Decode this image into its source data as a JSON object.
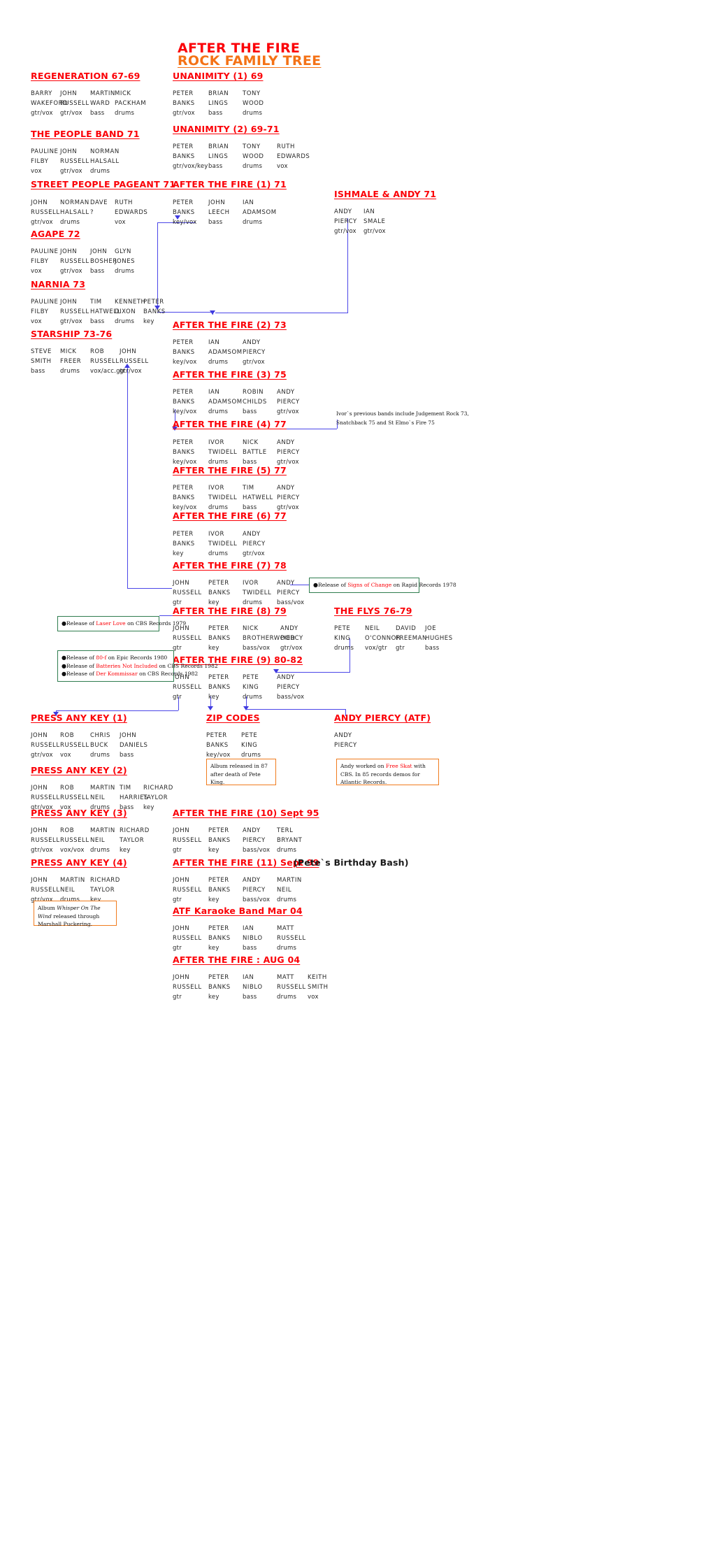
{
  "title": {
    "line1": "AFTER THE FIRE",
    "line2": "ROCK FAMILY TREE",
    "color_line1": "#fb0007",
    "color_line2": "#f47216"
  },
  "colors": {
    "heading": "#fb0007",
    "connector": "#4b46e8",
    "note_green_border": "#2f7d4f",
    "note_orange_border": "#f07c1e",
    "text": "#262626"
  },
  "bands": [
    {
      "id": "regeneration",
      "heading": "REGENERATION 67-69",
      "members": [
        {
          "first": "BARRY",
          "last": "WAKEFORD",
          "role": "gtr/vox"
        },
        {
          "first": "JOHN",
          "last": "RUSSELL",
          "role": "gtr/vox"
        },
        {
          "first": "MARTIN",
          "last": "WARD",
          "role": "bass"
        },
        {
          "first": "MICK",
          "last": "PACKHAM",
          "role": "drums"
        }
      ]
    },
    {
      "id": "people-band",
      "heading": "THE PEOPLE BAND 71",
      "members": [
        {
          "first": "PAULINE",
          "last": "FILBY",
          "role": "vox"
        },
        {
          "first": "JOHN",
          "last": "RUSSELL",
          "role": "gtr/vox"
        },
        {
          "first": "NORMAN",
          "last": "HALSALL",
          "role": "drums"
        }
      ]
    },
    {
      "id": "street-people-pageant",
      "heading": "STREET PEOPLE PAGEANT 71",
      "members": [
        {
          "first": "JOHN",
          "last": "RUSSELL",
          "role": "gtr/vox"
        },
        {
          "first": "NORMAN",
          "last": "HALSALL",
          "role": "drums"
        },
        {
          "first": "DAVE",
          "last": "?",
          "role": ""
        },
        {
          "first": "RUTH",
          "last": "EDWARDS",
          "role": "vox"
        }
      ]
    },
    {
      "id": "agape",
      "heading": "AGAPE 72",
      "members": [
        {
          "first": "PAULINE",
          "last": "FILBY",
          "role": "vox"
        },
        {
          "first": "JOHN",
          "last": "RUSSELL",
          "role": "gtr/vox"
        },
        {
          "first": "JOHN",
          "last": "BOSHER",
          "role": "bass"
        },
        {
          "first": "GLYN",
          "last": "JONES",
          "role": "drums"
        }
      ]
    },
    {
      "id": "narnia",
      "heading": "NARNIA 73",
      "members": [
        {
          "first": "PAULINE",
          "last": "FILBY",
          "role": "vox"
        },
        {
          "first": "JOHN",
          "last": "RUSSELL",
          "role": "gtr/vox"
        },
        {
          "first": "TIM",
          "last": "HATWELL",
          "role": "bass"
        },
        {
          "first": "KENNETH",
          "last": "DIXON",
          "role": "drums"
        },
        {
          "first": "PETER",
          "last": "BANKS",
          "role": "key"
        }
      ]
    },
    {
      "id": "starship",
      "heading": "STARSHIP 73-76",
      "members": [
        {
          "first": "STEVE",
          "last": "SMITH",
          "role": "bass"
        },
        {
          "first": "MICK",
          "last": "FREER",
          "role": "drums"
        },
        {
          "first": "ROB",
          "last": "RUSSELL",
          "role": "vox/acc.gtr"
        },
        {
          "first": "JOHN",
          "last": "RUSSELL",
          "role": "gtr/vox"
        }
      ]
    },
    {
      "id": "unanimity-1",
      "heading": "UNANIMITY (1) 69",
      "members": [
        {
          "first": "PETER",
          "last": "BANKS",
          "role": "gtr/vox"
        },
        {
          "first": "BRIAN",
          "last": "LINGS",
          "role": "bass"
        },
        {
          "first": "TONY",
          "last": "WOOD",
          "role": "drums"
        }
      ]
    },
    {
      "id": "unanimity-2",
      "heading": "UNANIMITY (2) 69-71",
      "members": [
        {
          "first": "PETER",
          "last": "BANKS",
          "role": "gtr/vox/key"
        },
        {
          "first": "BRIAN",
          "last": "LINGS",
          "role": "bass"
        },
        {
          "first": "TONY",
          "last": "WOOD",
          "role": "drums"
        },
        {
          "first": "RUTH",
          "last": "EDWARDS",
          "role": "vox"
        }
      ]
    },
    {
      "id": "atf-1",
      "heading": "AFTER THE FIRE (1) 71",
      "members": [
        {
          "first": "PETER",
          "last": "BANKS",
          "role": "key/vox"
        },
        {
          "first": "JOHN",
          "last": "LEECH",
          "role": "bass"
        },
        {
          "first": "IAN",
          "last": "ADAMSOM",
          "role": "drums"
        }
      ]
    },
    {
      "id": "ishmale-andy",
      "heading": "ISHMALE & ANDY 71",
      "members": [
        {
          "first": "ANDY",
          "last": "PIERCY",
          "role": "gtr/vox"
        },
        {
          "first": "IAN",
          "last": "SMALE",
          "role": "gtr/vox"
        }
      ]
    },
    {
      "id": "atf-2",
      "heading": "AFTER THE FIRE (2) 73",
      "members": [
        {
          "first": "PETER",
          "last": "BANKS",
          "role": "key/vox"
        },
        {
          "first": "IAN",
          "last": "ADAMSOM",
          "role": "drums"
        },
        {
          "first": "ANDY",
          "last": "PIERCY",
          "role": "gtr/vox"
        }
      ]
    },
    {
      "id": "atf-3",
      "heading": "AFTER THE FIRE (3) 75",
      "members": [
        {
          "first": "PETER",
          "last": "BANKS",
          "role": "key/vox"
        },
        {
          "first": "IAN",
          "last": "ADAMSOM",
          "role": "drums"
        },
        {
          "first": "ROBIN",
          "last": "CHILDS",
          "role": "bass"
        },
        {
          "first": "ANDY",
          "last": "PIERCY",
          "role": "gtr/vox"
        }
      ]
    },
    {
      "id": "atf-4",
      "heading": "AFTER THE FIRE (4) 77",
      "members": [
        {
          "first": "PETER",
          "last": "BANKS",
          "role": "key/vox"
        },
        {
          "first": "IVOR",
          "last": "TWIDELL",
          "role": "drums"
        },
        {
          "first": "NICK",
          "last": "BATTLE",
          "role": "bass"
        },
        {
          "first": "ANDY",
          "last": "PIERCY",
          "role": "gtr/vox"
        }
      ]
    },
    {
      "id": "atf-5",
      "heading": "AFTER THE FIRE (5) 77",
      "members": [
        {
          "first": "PETER",
          "last": "BANKS",
          "role": "key/vox"
        },
        {
          "first": "IVOR",
          "last": "TWIDELL",
          "role": "drums"
        },
        {
          "first": "TIM",
          "last": "HATWELL",
          "role": "bass"
        },
        {
          "first": "ANDY",
          "last": "PIERCY",
          "role": "gtr/vox"
        }
      ]
    },
    {
      "id": "atf-6",
      "heading": "AFTER THE FIRE (6) 77",
      "members": [
        {
          "first": "PETER",
          "last": "BANKS",
          "role": "key"
        },
        {
          "first": "IVOR",
          "last": "TWIDELL",
          "role": "drums"
        },
        {
          "first": "ANDY",
          "last": "PIERCY",
          "role": "gtr/vox"
        }
      ]
    },
    {
      "id": "atf-7",
      "heading": "AFTER THE FIRE (7) 78",
      "members": [
        {
          "first": "JOHN",
          "last": "RUSSELL",
          "role": "gtr"
        },
        {
          "first": "PETER",
          "last": "BANKS",
          "role": "key"
        },
        {
          "first": "IVOR",
          "last": "TWIDELL",
          "role": "drums"
        },
        {
          "first": "ANDY",
          "last": "PIERCY",
          "role": "bass/vox"
        }
      ]
    },
    {
      "id": "atf-8",
      "heading": "AFTER THE FIRE (8) 79",
      "members": [
        {
          "first": "JOHN",
          "last": "RUSSELL",
          "role": "gtr"
        },
        {
          "first": "PETER",
          "last": "BANKS",
          "role": "key"
        },
        {
          "first": "NICK",
          "last": "BROTHERWOOD",
          "role": "bass/vox"
        },
        {
          "first": "ANDY",
          "last": "PIERCY",
          "role": "gtr/vox"
        }
      ]
    },
    {
      "id": "the-flys",
      "heading": "THE FLYS 76-79",
      "members": [
        {
          "first": "PETE",
          "last": "KING",
          "role": "drums"
        },
        {
          "first": "NEIL",
          "last": "O'CONNOR",
          "role": "vox/gtr"
        },
        {
          "first": "DAVID",
          "last": "FREEMAN",
          "role": "gtr"
        },
        {
          "first": "JOE",
          "last": "HUGHES",
          "role": "bass"
        }
      ]
    },
    {
      "id": "atf-9",
      "heading": "AFTER THE FIRE (9) 80-82",
      "members": [
        {
          "first": "JOHN",
          "last": "RUSSELL",
          "role": "gtr"
        },
        {
          "first": "PETER",
          "last": "BANKS",
          "role": "key"
        },
        {
          "first": "PETE",
          "last": "KING",
          "role": "drums"
        },
        {
          "first": "ANDY",
          "last": "PIERCY",
          "role": "bass/vox"
        }
      ]
    },
    {
      "id": "press-any-key-1",
      "heading": "PRESS ANY KEY (1)",
      "members": [
        {
          "first": "JOHN",
          "last": "RUSSELL",
          "role": "gtr/vox"
        },
        {
          "first": "ROB",
          "last": "RUSSELL",
          "role": "vox"
        },
        {
          "first": "CHRIS",
          "last": "BUCK",
          "role": "drums"
        },
        {
          "first": "JOHN",
          "last": "DANIELS",
          "role": "bass"
        }
      ]
    },
    {
      "id": "zip-codes",
      "heading": "ZIP CODES",
      "members": [
        {
          "first": "PETER",
          "last": "BANKS",
          "role": "key/vox"
        },
        {
          "first": "PETE",
          "last": "KING",
          "role": "drums"
        }
      ]
    },
    {
      "id": "andy-piercy-atf",
      "heading": "ANDY PIERCY (ATF)",
      "members": [
        {
          "first": "ANDY",
          "last": "PIERCY",
          "role": ""
        }
      ]
    },
    {
      "id": "press-any-key-2",
      "heading": "PRESS ANY KEY (2)",
      "members": [
        {
          "first": "JOHN",
          "last": "RUSSELL",
          "role": "gtr/vox"
        },
        {
          "first": "ROB",
          "last": "RUSSELL",
          "role": "vox"
        },
        {
          "first": "MARTIN",
          "last": "NEIL",
          "role": "drums"
        },
        {
          "first": "TIM",
          "last": "HARRIES",
          "role": "bass"
        },
        {
          "first": "RICHARD",
          "last": "TAYLOR",
          "role": "key"
        }
      ]
    },
    {
      "id": "press-any-key-3",
      "heading": "PRESS ANY KEY (3)",
      "members": [
        {
          "first": "JOHN",
          "last": "RUSSELL",
          "role": "gtr/vox"
        },
        {
          "first": "ROB",
          "last": "RUSSELL",
          "role": "vox/vox"
        },
        {
          "first": "MARTIN",
          "last": "NEIL",
          "role": "drums"
        },
        {
          "first": "RICHARD",
          "last": "TAYLOR",
          "role": "key"
        }
      ]
    },
    {
      "id": "atf-10",
      "heading": "AFTER THE FIRE (10) Sept 95",
      "members": [
        {
          "first": "JOHN",
          "last": "RUSSELL",
          "role": "gtr"
        },
        {
          "first": "PETER",
          "last": "BANKS",
          "role": "key"
        },
        {
          "first": "ANDY",
          "last": "PIERCY",
          "role": "bass/vox"
        },
        {
          "first": "TERL",
          "last": "BRYANT",
          "role": "drums"
        }
      ]
    },
    {
      "id": "press-any-key-4",
      "heading": "PRESS ANY KEY (4)",
      "members": [
        {
          "first": "JOHN",
          "last": "RUSSELL",
          "role": "gtr/vox"
        },
        {
          "first": "MARTIN",
          "last": "NEIL",
          "role": "drums"
        },
        {
          "first": "RICHARD",
          "last": "TAYLOR",
          "role": "key"
        }
      ]
    },
    {
      "id": "atf-11",
      "heading": "AFTER THE FIRE (11) Sept 99",
      "members": [
        {
          "first": "JOHN",
          "last": "RUSSELL",
          "role": "gtr"
        },
        {
          "first": "PETER",
          "last": "BANKS",
          "role": "key"
        },
        {
          "first": "ANDY",
          "last": "PIERCY",
          "role": "bass/vox"
        },
        {
          "first": "MARTIN",
          "last": "NEIL",
          "role": "drums"
        }
      ]
    },
    {
      "id": "atf-karaoke",
      "heading": "ATF Karaoke Band  Mar 04",
      "members": [
        {
          "first": "JOHN",
          "last": "RUSSELL",
          "role": "gtr"
        },
        {
          "first": "PETER",
          "last": "BANKS",
          "role": "key"
        },
        {
          "first": "IAN",
          "last": "NIBLO",
          "role": "bass"
        },
        {
          "first": "MATT",
          "last": "RUSSELL",
          "role": "drums"
        }
      ]
    },
    {
      "id": "atf-aug04",
      "heading": "AFTER THE FIRE : AUG 04",
      "members": [
        {
          "first": "JOHN",
          "last": "RUSSELL",
          "role": "gtr"
        },
        {
          "first": "PETER",
          "last": "BANKS",
          "role": "key"
        },
        {
          "first": "IAN",
          "last": "NIBLO",
          "role": "bass"
        },
        {
          "first": "MATT",
          "last": "RUSSELL",
          "role": "drums"
        },
        {
          "first": "KEITH",
          "last": "SMITH",
          "role": "vox"
        }
      ]
    }
  ],
  "plain_notes": [
    {
      "id": "petes-birthday-bash",
      "text": "(Pete`s Birthday Bash)"
    }
  ],
  "side_notes": [
    {
      "id": "ivor-previous-bands",
      "line1": "Ivor`s previous bands include Judgement Rock 73,",
      "line2": "Snatchback 75 and St Elmo`s Fire 75"
    }
  ],
  "note_boxes": [
    {
      "id": "signs-of-change",
      "border": "green",
      "lines": [
        {
          "pre": "Release of ",
          "em": "Signs of Change",
          "post": " on Rapid Records 1978"
        }
      ]
    },
    {
      "id": "laser-love",
      "border": "green",
      "lines": [
        {
          "pre": "Release of ",
          "em": "Laser Love",
          "post": " on CBS Records 1979"
        }
      ]
    },
    {
      "id": "80f-batteries-kommissar",
      "border": "green",
      "lines": [
        {
          "pre": "Release of ",
          "em": "80-f",
          "post": " on Epic Records 1980"
        },
        {
          "pre": "Release of ",
          "em": "Batteries Not Included",
          "post": " on CBS Records 1982"
        },
        {
          "pre": "Release of ",
          "em": "Der Kommissar",
          "post": " on CBS Records 1982"
        }
      ]
    },
    {
      "id": "album-released-87",
      "border": "orange",
      "plain": "Album released in 87 after death of Pete King."
    },
    {
      "id": "andy-free-skat",
      "border": "orange",
      "plain_pre": "Andy worked on ",
      "plain_em": "Free Skat",
      "plain_post": " with CBS. In 85 records demos for Atlantic Records."
    },
    {
      "id": "whisper-on-the-wind",
      "border": "orange",
      "plain_pre": "Album ",
      "plain_em": "Whisper On The Wind",
      "plain_post": " released through Marshall Puckering."
    }
  ]
}
